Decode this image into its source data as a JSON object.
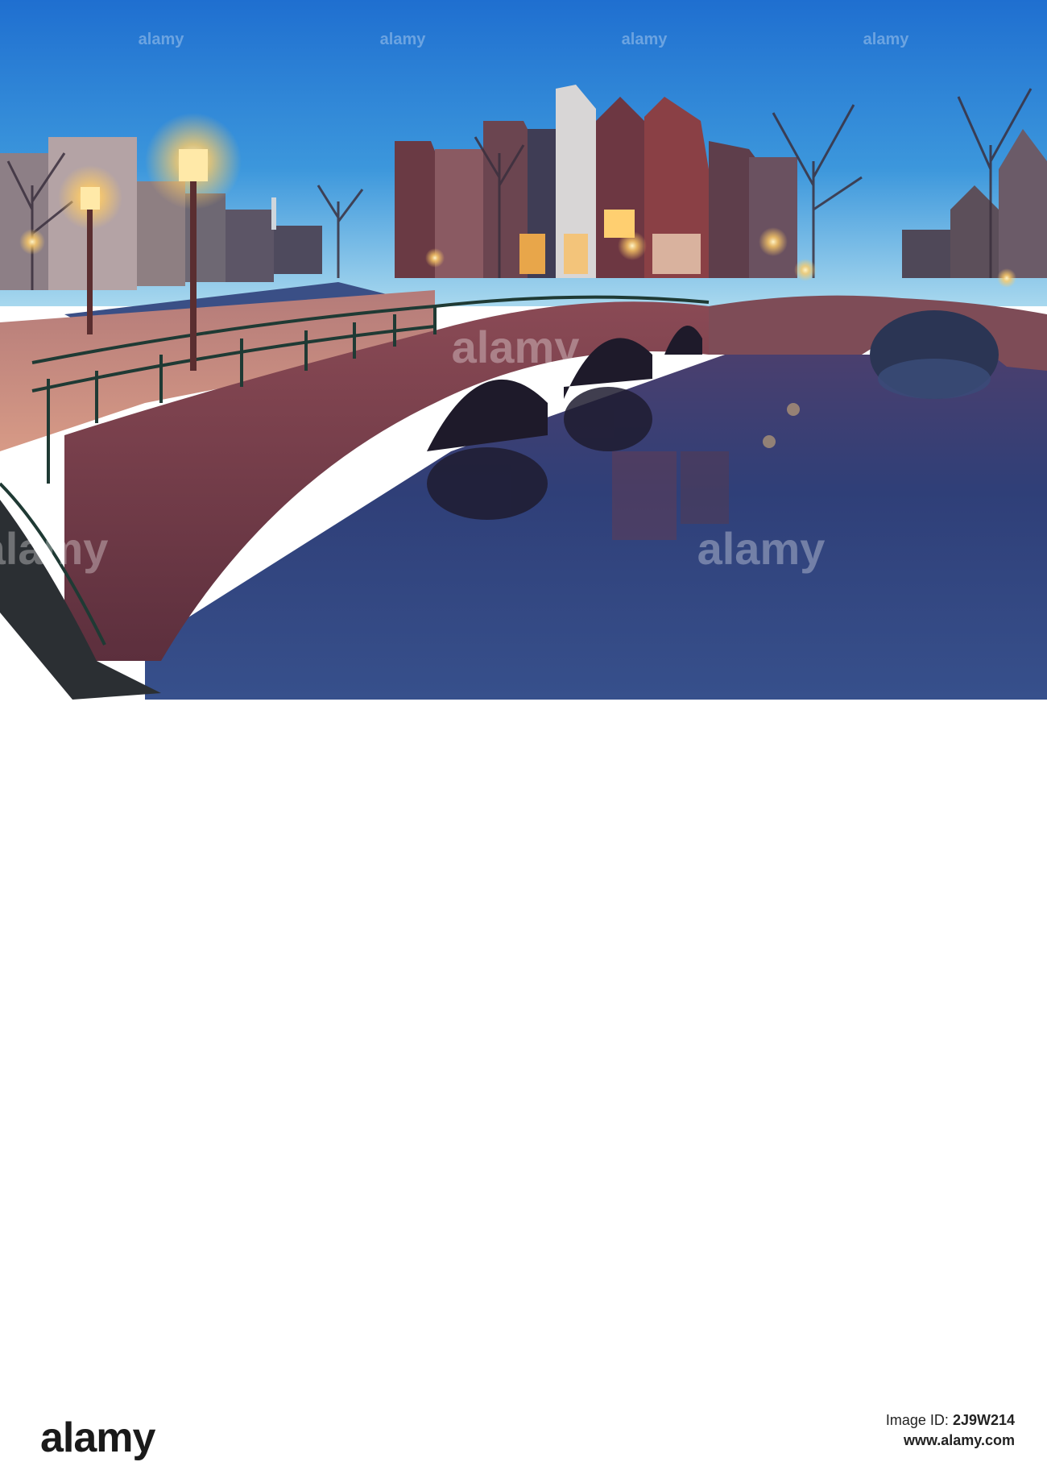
{
  "watermark": {
    "text": "alamy",
    "color": "rgba(255,255,255,0.32)"
  },
  "footer": {
    "brand": "alamy",
    "image_id_label": "Image ID:",
    "image_id": "2J9W214",
    "url": "www.alamy.com"
  },
  "colors": {
    "sky_top": "#2f86d8",
    "sky_horizon": "#9fd3ec",
    "water": "#2b3f7a",
    "brick": "#7a3e47",
    "lamp_glow": "#ffd27a"
  }
}
